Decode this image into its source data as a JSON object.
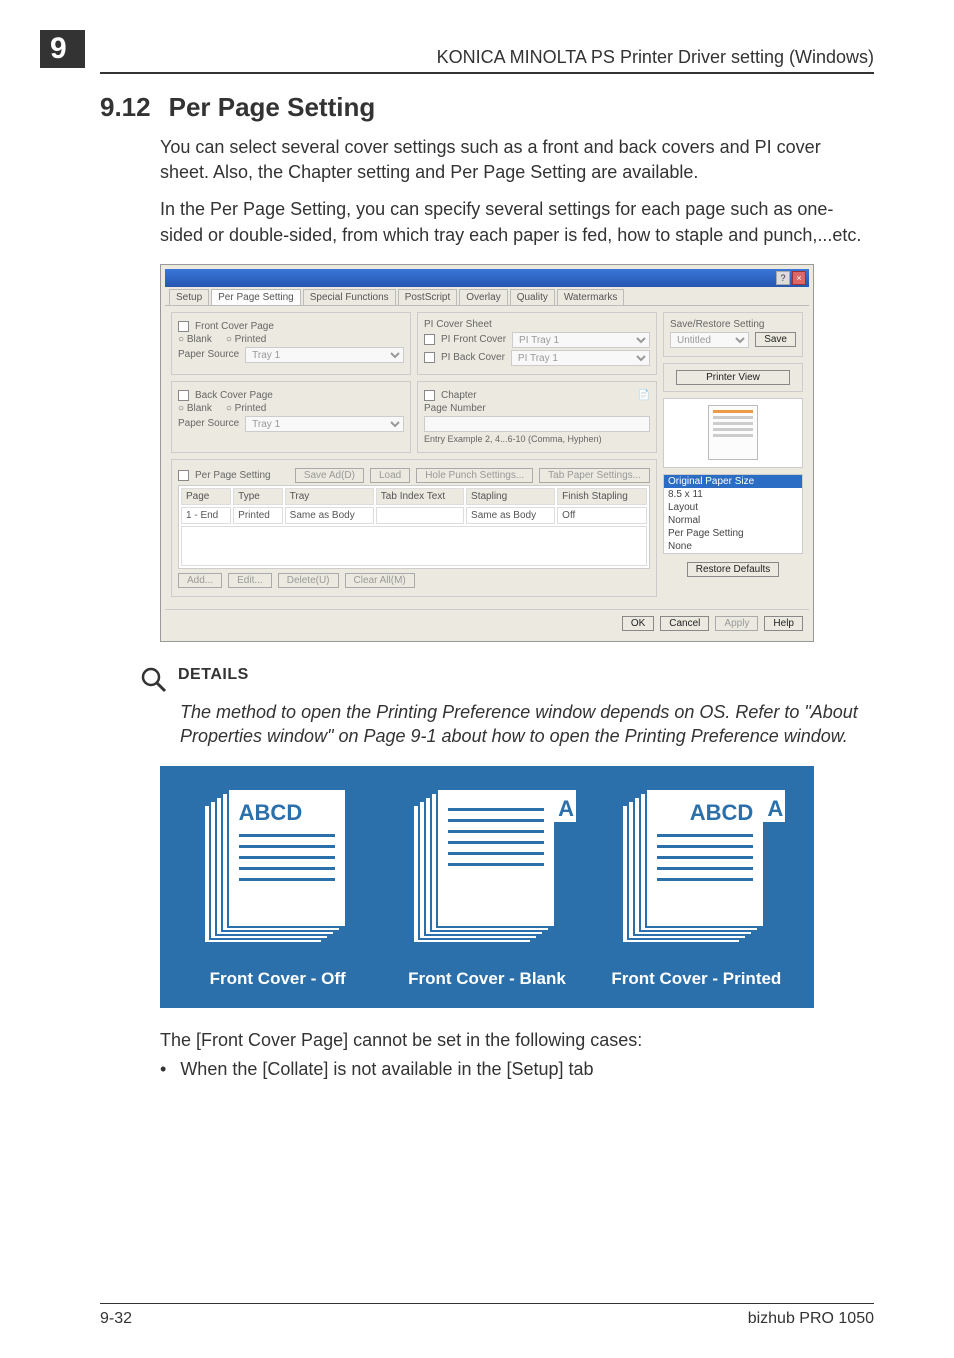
{
  "header": {
    "chapter_number": "9",
    "title": "KONICA MINOLTA PS Printer Driver setting (Windows)"
  },
  "section": {
    "number": "9.12",
    "title": "Per Page Setting"
  },
  "paragraphs": {
    "p1": "You can select several cover settings such as a front and back covers and PI cover sheet. Also, the Chapter setting and Per Page Setting are available.",
    "p2": "In the Per Page Setting, you can specify several settings for each page such as one-sided or double-sided, from which tray each paper is fed, how to staple and punch,...etc."
  },
  "dialog": {
    "tabs": [
      "Setup",
      "Per Page Setting",
      "Special Functions",
      "PostScript",
      "Overlay",
      "Quality",
      "Watermarks"
    ],
    "active_tab": "Per Page Setting",
    "front_cover": {
      "label": "Front Cover Page",
      "blank": "Blank",
      "printed": "Printed",
      "paper_source_label": "Paper Source",
      "paper_source_value": "Tray 1"
    },
    "back_cover": {
      "label": "Back Cover Page",
      "blank": "Blank",
      "printed": "Printed",
      "paper_source_label": "Paper Source",
      "paper_source_value": "Tray 1"
    },
    "pi_cover": {
      "label": "PI Cover Sheet",
      "front_label": "PI Front Cover",
      "front_value": "PI Tray 1",
      "back_label": "PI Back Cover",
      "back_value": "PI Tray 1"
    },
    "chapter": {
      "label": "Chapter",
      "page_number_label": "Page Number",
      "example": "Entry Example 2, 4...6-10 (Comma, Hyphen)"
    },
    "per_page": {
      "label": "Per Page Setting",
      "save_add": "Save Ad(D)",
      "load": "Load",
      "hole_punch": "Hole Punch Settings...",
      "tab_paper": "Tab Paper Settings..."
    },
    "table": {
      "headers": [
        "Page",
        "Type",
        "Tray",
        "Tab Index Text",
        "Stapling",
        "Finish Stapling"
      ],
      "row": [
        "1 - End",
        "Printed",
        "Same as Body",
        "",
        "Same as Body",
        "Off"
      ]
    },
    "row_buttons": {
      "add": "Add...",
      "edit": "Edit...",
      "delete": "Delete(U)",
      "clear": "Clear All(M)"
    },
    "save_restore": {
      "group": "Save/Restore Setting",
      "name": "Untitled",
      "save": "Save",
      "printer_view": "Printer View"
    },
    "info": {
      "header": "Original Paper Size",
      "items": [
        "8.5 x 11",
        "Layout",
        "Normal",
        "Per Page Setting",
        "None"
      ]
    },
    "restore_defaults": "Restore Defaults",
    "footer": {
      "ok": "OK",
      "cancel": "Cancel",
      "apply": "Apply",
      "help": "Help"
    }
  },
  "details": {
    "label": "DETAILS",
    "text": "The method to open the Printing Preference window depends on OS. Refer to \"About Properties window\" on Page 9-1 about how to open the Printing Preference window."
  },
  "diagram": {
    "label_full": "ABCD",
    "label_short": "A",
    "captions": {
      "c1": "Front Cover - Off",
      "c2": "Front Cover - Blank",
      "c3": "Front Cover - Printed"
    }
  },
  "note": {
    "intro": "The [Front Cover Page] cannot be set in the following cases:",
    "bullet": "When the [Collate] is not available in the [Setup] tab"
  },
  "footer": {
    "left": "9-32",
    "right": "bizhub PRO 1050"
  }
}
